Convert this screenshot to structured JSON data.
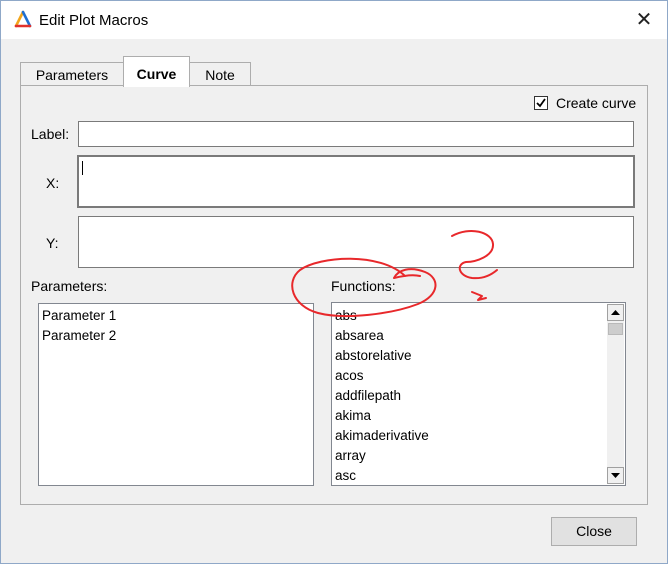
{
  "window": {
    "title": "Edit Plot Macros",
    "close_glyph": "✕",
    "app_icon": "app-logo-icon"
  },
  "tabs": [
    {
      "label": "Parameters",
      "active": false
    },
    {
      "label": "Curve",
      "active": true
    },
    {
      "label": "Note",
      "active": false
    }
  ],
  "curve": {
    "create_curve_label": "Create curve",
    "create_curve_checked": true,
    "label_caption": "Label:",
    "label_value": "",
    "x_caption": "X:",
    "x_value": "",
    "y_caption": "Y:",
    "y_value": ""
  },
  "parameters": {
    "heading": "Parameters:",
    "items": [
      "Parameter 1",
      "Parameter 2"
    ]
  },
  "functions": {
    "heading": "Functions:",
    "items": [
      "abs",
      "absarea",
      "abstorelative",
      "acos",
      "addfilepath",
      "akima",
      "akimaderivative",
      "array",
      "asc"
    ]
  },
  "buttons": {
    "close_label": "Close"
  },
  "annotation": {
    "color": "#e8282b",
    "marks": "red-freehand-circle-and-question-mark"
  }
}
